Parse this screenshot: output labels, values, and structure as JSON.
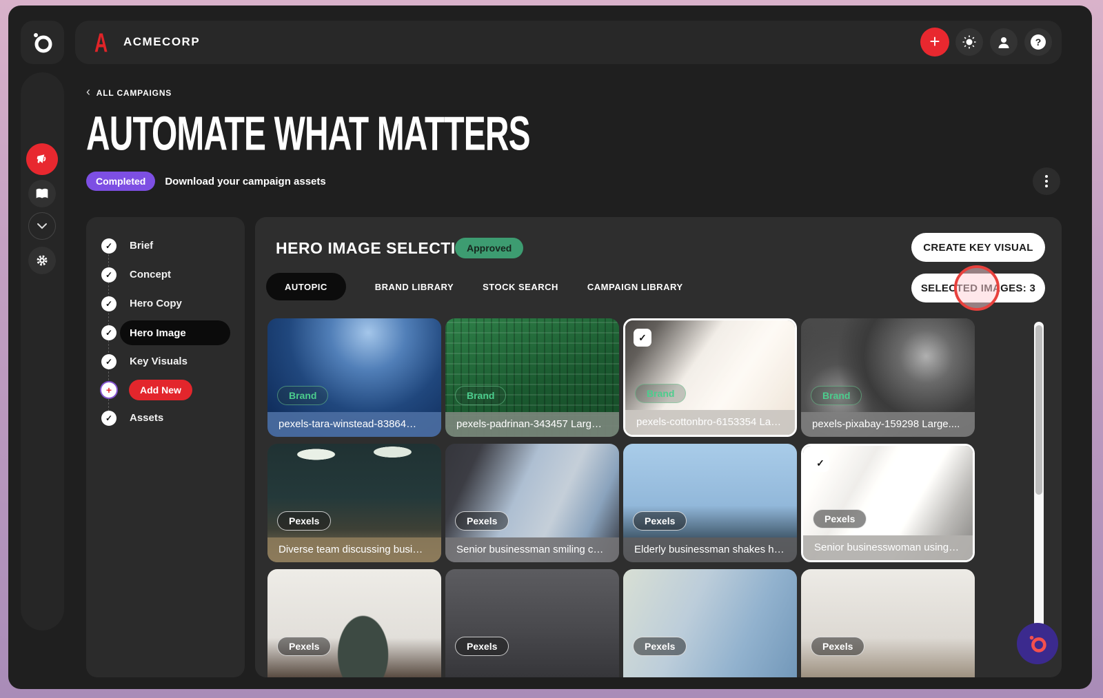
{
  "topbar": {
    "brand_letter": "A",
    "brand_name": "ACMECORP",
    "icons": [
      "plus",
      "theme-sun",
      "user",
      "help"
    ]
  },
  "breadcrumb": {
    "label": "ALL CAMPAIGNS"
  },
  "header": {
    "title": "AUTOMATE WHAT MATTERS",
    "status_badge": "Completed",
    "status_text": "Download your campaign assets"
  },
  "steps": {
    "items": [
      {
        "label": "Brief",
        "state": "done"
      },
      {
        "label": "Concept",
        "state": "done"
      },
      {
        "label": "Hero Copy",
        "state": "done"
      },
      {
        "label": "Hero Image",
        "state": "active"
      },
      {
        "label": "Key Visuals",
        "state": "done"
      },
      {
        "label": "Add New",
        "state": "add-button"
      },
      {
        "label": "Assets",
        "state": "done"
      }
    ]
  },
  "panel": {
    "heading": "HERO IMAGE SELECTION",
    "approved_badge": "Approved",
    "tabs": [
      "AUTOPIC",
      "BRAND LIBRARY",
      "STOCK SEARCH",
      "CAMPAIGN LIBRARY"
    ],
    "active_tab": "AUTOPIC",
    "create_button": "CREATE KEY VISUAL",
    "selected_button": "SELECTED IMAGES: 3",
    "selected_count": 3
  },
  "grid": {
    "cards": [
      {
        "caption": "pexels-tara-winstead-83864…",
        "badge": "Brand",
        "selected": false
      },
      {
        "caption": "pexels-padrinan-343457 Larg…",
        "badge": "Brand",
        "selected": false
      },
      {
        "caption": "pexels-cottonbro-6153354 Lar…",
        "badge": "Brand",
        "selected": true
      },
      {
        "caption": "pexels-pixabay-159298 Large....",
        "badge": "Brand",
        "selected": false
      },
      {
        "caption": "Diverse team discussing busi…",
        "badge": "Pexels",
        "selected": false
      },
      {
        "caption": "Senior businessman smiling c…",
        "badge": "Pexels",
        "selected": false
      },
      {
        "caption": "Elderly businessman shakes h…",
        "badge": "Pexels",
        "selected": false
      },
      {
        "caption": "Senior businesswoman using l…",
        "badge": "Pexels",
        "selected": true
      },
      {
        "caption": "",
        "badge": "Pexels",
        "selected": false
      },
      {
        "caption": "",
        "badge": "Pexels",
        "selected": false
      },
      {
        "caption": "",
        "badge": "Pexels",
        "selected": false
      },
      {
        "caption": "",
        "badge": "Pexels",
        "selected": false
      }
    ]
  },
  "colors": {
    "accent_red": "#e8282f",
    "purple_badge": "#7d4fe3",
    "approved_green": "#3d9c71",
    "brand_green": "#4ccd8d",
    "annotation_red": "#e8413d",
    "fab_purple": "#3b2a8e"
  }
}
